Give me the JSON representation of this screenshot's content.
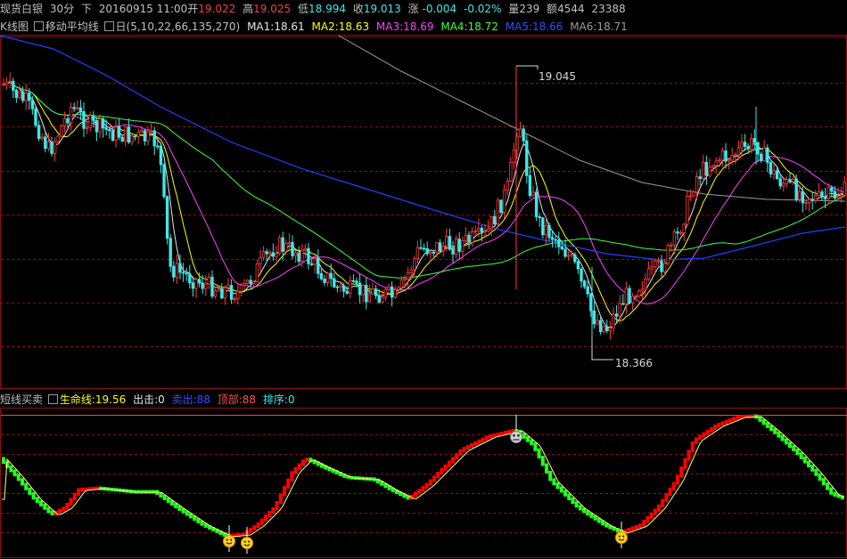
{
  "topbar": {
    "instrument": "现货白银",
    "period": "30分",
    "direction": "下",
    "datetime": "20160915 11:00",
    "open_label": "开",
    "open_value": "19.022",
    "high_label": "高",
    "high_value": "19.025",
    "low_label": "低",
    "low_value": "18.994",
    "close_label": "收",
    "close_value": "19.013",
    "change_label": "涨",
    "change_value": "-0.004",
    "change_pct": "-0.02%",
    "volume_label": "量",
    "volume_value": "239",
    "amount_label": "额",
    "amount_value": "4544",
    "extra_value": "23388"
  },
  "kline_legend": {
    "title": "K线图",
    "ma_name": "移动平均线",
    "ma_params": "日(5,10,22,66,135,270)",
    "ma1": "MA1:18.61",
    "ma2": "MA2:18.63",
    "ma3": "MA3:18.69",
    "ma4": "MA4:18.72",
    "ma5": "MA5:18.66",
    "ma6": "MA6:18.71"
  },
  "indicator_legend": {
    "title": "短线买卖",
    "lifeline_prefix": "生命线:",
    "lifeline_value": "19.56",
    "hit": "出击:0",
    "sell": "卖出:88",
    "top": "顶部:88",
    "rank": "排序:0"
  },
  "price_labels": {
    "high": "19.045",
    "low": "18.366"
  },
  "colors": {
    "up": "#ff3c3c",
    "down": "#3ee8e8",
    "ma1": "#e6e6e6",
    "ma2": "#ffff00",
    "ma3": "#ff40ff",
    "ma4": "#40ff40",
    "ma5": "#2040ff",
    "ma6": "#9a9a9a",
    "grid": "#8b1010",
    "ind_up": "#ff0000",
    "ind_down": "#20ff20",
    "lifeline": "#ffff80"
  },
  "icons": {
    "buy_signal": "smiley-face-icon",
    "sell_signal": "skull-face-icon"
  }
}
